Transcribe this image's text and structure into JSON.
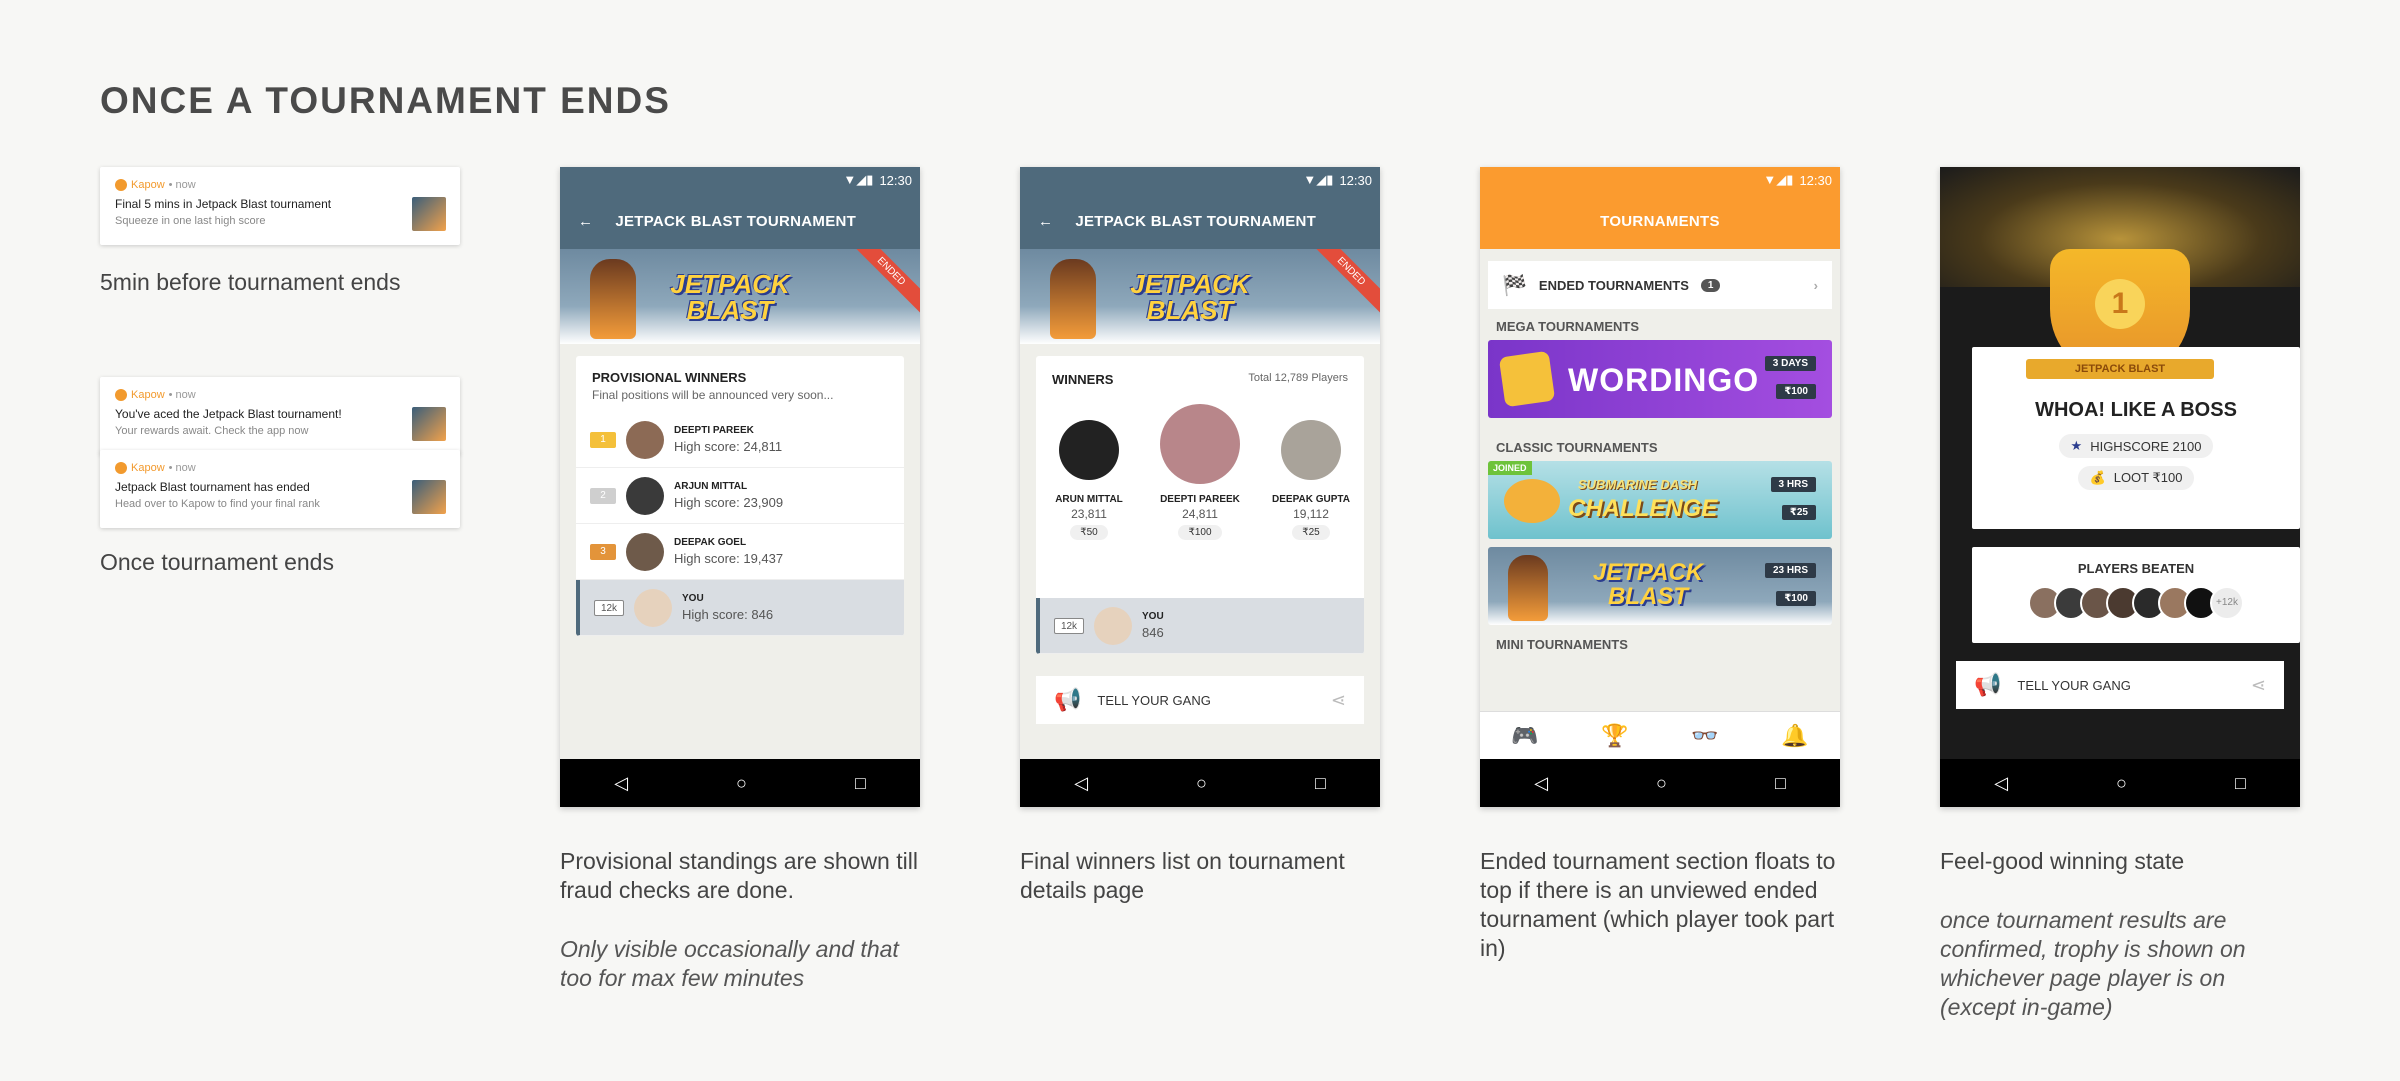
{
  "page_title": "ONCE A TOURNAMENT ENDS",
  "notifications": {
    "app": "Kapow",
    "time": "• now",
    "n1": {
      "title": "Final 5 mins in Jetpack Blast tournament",
      "sub": "Squeeze in one last high score"
    },
    "n2": {
      "title": "You've aced the Jetpack Blast tournament!",
      "sub": "Your rewards await. Check the app now"
    },
    "n3": {
      "title": "Jetpack Blast tournament has ended",
      "sub": "Head over to Kapow to find your final rank"
    },
    "caption1": "5min before tournament ends",
    "caption2": "Once tournament ends"
  },
  "status_time": "12:30",
  "screen1": {
    "appbar": "JETPACK BLAST TOURNAMENT",
    "banner_logo": "JETPACK BLAST",
    "ribbon": "ENDED",
    "card_title": "PROVISIONAL WINNERS",
    "card_sub": "Final positions will be announced very soon...",
    "rows": [
      {
        "rank": "1",
        "name": "DEEPTI PAREEK",
        "score": "High score: 24,811"
      },
      {
        "rank": "2",
        "name": "ARJUN MITTAL",
        "score": "High score: 23,909"
      },
      {
        "rank": "3",
        "name": "DEEPAK GOEL",
        "score": "High score: 19,437"
      },
      {
        "rank": "12k",
        "name": "YOU",
        "score": "High score: 846"
      }
    ],
    "caption": "Provisional standings are shown till fraud checks are done.",
    "note": "Only visible occasionally and that too for max few minutes"
  },
  "screen2": {
    "appbar": "JETPACK BLAST TOURNAMENT",
    "card_title": "WINNERS",
    "total": "Total 12,789 Players",
    "podium": [
      {
        "name": "ARUN MITTAL",
        "score": "23,811",
        "prize": "₹50"
      },
      {
        "name": "DEEPTI PAREEK",
        "score": "24,811",
        "prize": "₹100"
      },
      {
        "name": "DEEPAK GUPTA",
        "score": "19,112",
        "prize": "₹25"
      }
    ],
    "you_rank": "12k",
    "you_name": "YOU",
    "you_score": "846",
    "tell": "TELL YOUR GANG",
    "caption": "Final winners list on tournament details page"
  },
  "screen3": {
    "appbar": "TOURNAMENTS",
    "ended_label": "ENDED TOURNAMENTS",
    "ended_count": "1",
    "mega": "MEGA TOURNAMENTS",
    "wordingo": "WORDINGO",
    "wordingo_time": "3 DAYS",
    "wordingo_prize": "₹100",
    "classic": "CLASSIC TOURNAMENTS",
    "joined": "JOINED",
    "sub_title": "SUBMARINE DASH",
    "sub_challenge": "CHALLENGE",
    "sub_time": "3 HRS",
    "sub_prize": "₹25",
    "jet_time": "23 HRS",
    "jet_prize": "₹100",
    "mini": "MINI TOURNAMENTS",
    "caption": "Ended tournament section floats to top if there is an unviewed ended tournament (which player took part in)"
  },
  "screen4": {
    "trophy_rank": "1",
    "trophy_ribbon": "JETPACK BLAST",
    "headline": "WHOA! LIKE A BOSS",
    "highscore": "HIGHSCORE 2100",
    "loot": "LOOT ₹100",
    "beaten": "PLAYERS BEATEN",
    "more": "+12k",
    "tell": "TELL YOUR GANG",
    "caption": "Feel-good winning state",
    "note": "once tournament results are confirmed, trophy is shown on whichever page player is on (except in-game)"
  }
}
